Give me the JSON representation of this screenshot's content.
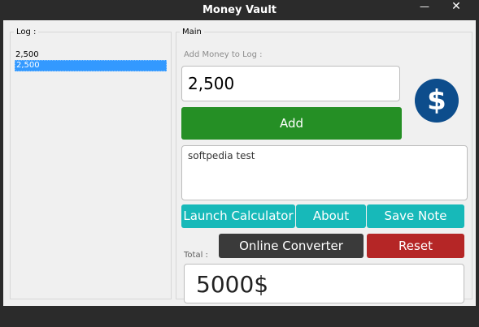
{
  "window": {
    "title": "Money Vault",
    "minimize_icon": "minimize-icon",
    "close_icon": "close-icon",
    "minimize_glyph": "—",
    "close_glyph": "✕"
  },
  "log": {
    "legend": "Log :",
    "items": [
      "2,500",
      "2,500"
    ],
    "selected_index": 1
  },
  "main": {
    "legend": "Main",
    "add_label": "Add Money to Log :",
    "amount_value": "2,500",
    "add_button": "Add",
    "dollar_icon": "dollar-coin-icon",
    "dollar_glyph": "$",
    "note_value": "softpedia test",
    "buttons": {
      "launch_calculator": "Launch Calculator",
      "about": "About",
      "save_note": "Save Note",
      "online_converter": "Online Converter",
      "reset": "Reset"
    },
    "total_label": "Total :",
    "total_value": "5000$"
  },
  "colors": {
    "add": "#258f25",
    "teal": "#17b9b9",
    "dark": "#3a3a3a",
    "reset": "#b52626",
    "dollar": "#0d4d8c",
    "selection": "#3399ff"
  }
}
